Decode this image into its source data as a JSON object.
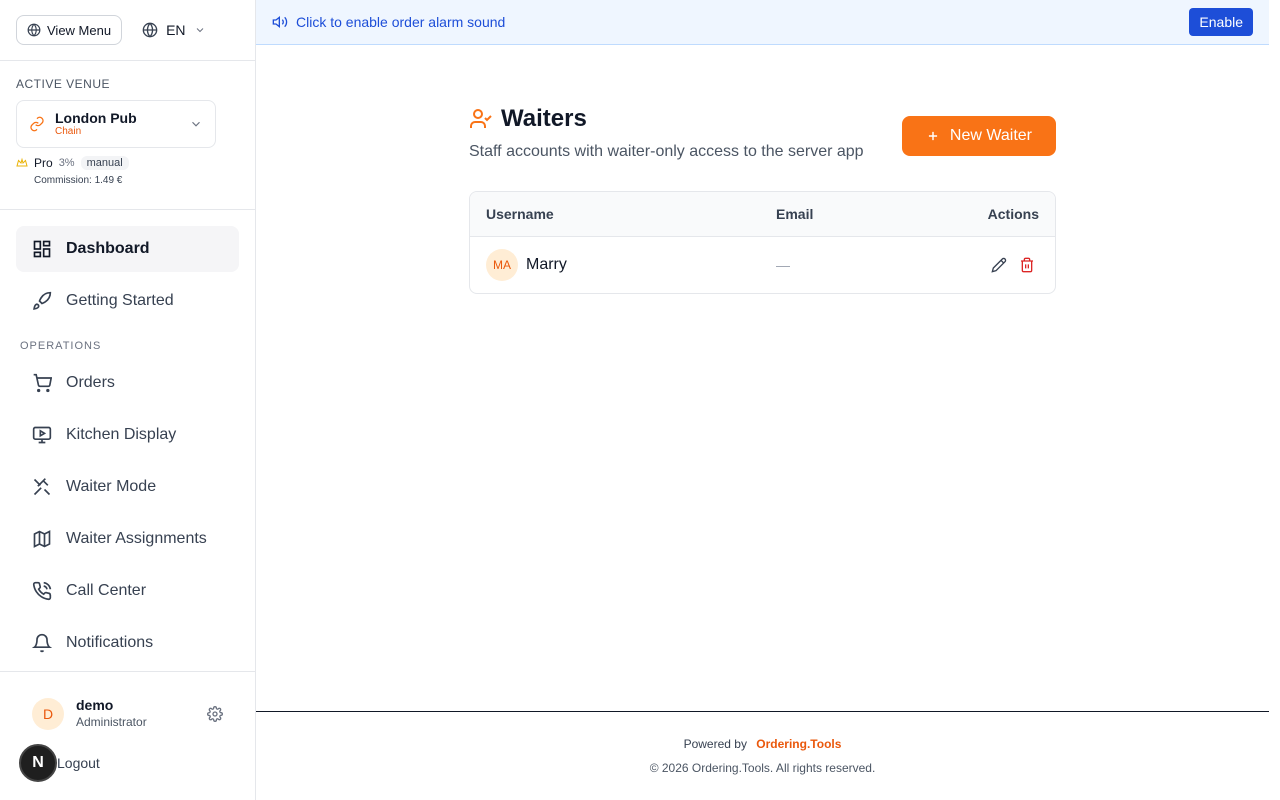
{
  "topbar": {
    "view_menu": "View Menu",
    "language": "EN"
  },
  "venue": {
    "label": "ACTIVE VENUE",
    "name": "London Pub",
    "sub": "Chain",
    "plan": "Pro",
    "plan_pct": "3%",
    "plan_mode": "manual",
    "commission": "Commission: 1.49 €"
  },
  "nav": {
    "dashboard": "Dashboard",
    "getting_started": "Getting Started",
    "section_operations": "OPERATIONS",
    "orders": "Orders",
    "kitchen_display": "Kitchen Display",
    "waiter_mode": "Waiter Mode",
    "waiter_assignments": "Waiter Assignments",
    "call_center": "Call Center",
    "notifications": "Notifications"
  },
  "user": {
    "initial": "D",
    "name": "demo",
    "role": "Administrator",
    "logout": "Logout",
    "next_badge": "N"
  },
  "banner": {
    "text": "Click to enable order alarm sound",
    "enable": "Enable"
  },
  "page": {
    "title": "Waiters",
    "subtitle": "Staff accounts with waiter-only access to the server app",
    "new_button": "New Waiter"
  },
  "table": {
    "headers": {
      "username": "Username",
      "email": "Email",
      "actions": "Actions"
    },
    "rows": [
      {
        "initials": "MA",
        "username": "Marry",
        "email": "—"
      }
    ]
  },
  "footer": {
    "powered_by": "Powered by",
    "brand": "Ordering.Tools",
    "copyright": "© 2026 Ordering.Tools. All rights reserved."
  },
  "colors": {
    "accent": "#f97316",
    "banner_bg": "#eff6ff",
    "banner_text": "#1d4ed8",
    "danger": "#dc2626"
  }
}
